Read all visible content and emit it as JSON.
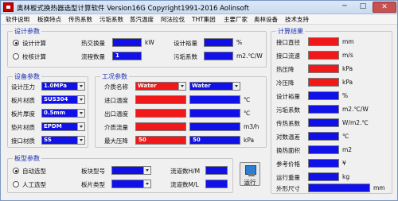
{
  "window": {
    "title": "奥林板式换热器选型计算软件  Version16G  Copyright1991-2016  Aolinsoft",
    "min": "─",
    "max": "□",
    "close": "✕"
  },
  "menu": [
    "软件说明",
    "板换特点",
    "传热系数",
    "污垢系数",
    "蒸汽温度",
    "阿法拉伐",
    "THT集团",
    "主要厂家",
    "奥林设备",
    "技术支持"
  ],
  "design_params": {
    "title": "设计参数",
    "radio_design": "设计计算",
    "radio_check": "校核计算",
    "heat_load_label": "热交换量",
    "heat_load_unit": "kW",
    "design_margin_label": "设计裕量",
    "design_margin_unit": "%",
    "flow_count_label": "流程数量",
    "flow_count_value": "1",
    "fouling_label": "污垢系数",
    "fouling_unit": "m2.℃/W"
  },
  "equipment_params": {
    "title": "设备参数",
    "pressure_label": "设计压力",
    "pressure_value": "1.0MPa",
    "plate_material_label": "板片材质",
    "plate_material_value": "SUS304",
    "plate_thickness_label": "板片厚度",
    "plate_thickness_value": "0.5mm",
    "gasket_material_label": "垫片材质",
    "gasket_material_value": "EPDM",
    "nozzle_material_label": "接口材质",
    "nozzle_material_value": "SS"
  },
  "conditions": {
    "title": "工况参数",
    "medium_label": "介质名称",
    "medium_hot": "Water",
    "medium_cold": "Water",
    "inlet_label": "进口温度",
    "outlet_label": "出口温度",
    "flow_label": "介质流量",
    "pressure_drop_label": "最大压降",
    "pressure_drop_hot": "50",
    "pressure_drop_cold": "50",
    "unit_temp1": "℃",
    "unit_temp2": "℃",
    "unit_flow": "m3/h",
    "unit_pressure": "kPa"
  },
  "plate_type": {
    "title": "板型参数",
    "radio_auto": "自动选型",
    "radio_manual": "人工选型",
    "plate_model_label": "板块型号",
    "plate_type_label": "板片类型",
    "channels_hm_label": "流道数H/M",
    "channels_ml_label": "流道数M/L",
    "run_label": "运行"
  },
  "results": {
    "title": "计算结果",
    "rows": [
      {
        "label": "接口直径",
        "unit": "mm",
        "color": "red"
      },
      {
        "label": "接口流速",
        "unit": "m/s",
        "color": "red"
      },
      {
        "label": "热压降",
        "unit": "kPa",
        "color": "red"
      },
      {
        "label": "冷压降",
        "unit": "kPa",
        "color": "red"
      },
      {
        "label": "设计裕量",
        "unit": "%",
        "color": "blue"
      },
      {
        "label": "污垢系数",
        "unit": "m2.℃/W",
        "color": "blue"
      },
      {
        "label": "传热系数",
        "unit": "W/m2.℃",
        "color": "blue"
      },
      {
        "label": "对数温差",
        "unit": "℃",
        "color": "blue"
      },
      {
        "label": "换热面积",
        "unit": "m2",
        "color": "blue"
      },
      {
        "label": "参考价格",
        "unit": "¥",
        "color": "blue"
      },
      {
        "label": "运行重量",
        "unit": "kg",
        "color": "blue"
      },
      {
        "label": "外形尺寸",
        "unit": "mm",
        "color": "blue"
      }
    ]
  }
}
